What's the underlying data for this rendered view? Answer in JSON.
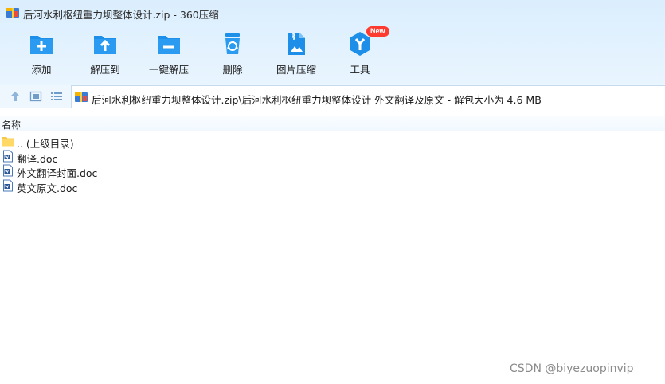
{
  "window": {
    "title": "后河水利枢纽重力坝整体设计.zip - 360压缩"
  },
  "toolbar": {
    "items": [
      {
        "label": "添加",
        "icon": "add-folder-icon"
      },
      {
        "label": "解压到",
        "icon": "extract-to-icon"
      },
      {
        "label": "一键解压",
        "icon": "one-click-extract-icon"
      },
      {
        "label": "删除",
        "icon": "trash-icon"
      },
      {
        "label": "图片压缩",
        "icon": "image-compress-icon"
      },
      {
        "label": "工具",
        "icon": "tools-icon",
        "badge": "New"
      }
    ]
  },
  "address_bar": {
    "path": "后河水利枢纽重力坝整体设计.zip\\后河水利枢纽重力坝整体设计 外文翻译及原文 - 解包大小为 4.6 MB"
  },
  "file_list": {
    "column_header": "名称",
    "rows": [
      {
        "name": ".. (上级目录)",
        "type": "parent-folder"
      },
      {
        "name": "翻译.doc",
        "type": "doc"
      },
      {
        "name": "外文翻译封面.doc",
        "type": "doc"
      },
      {
        "name": "英文原文.doc",
        "type": "doc"
      }
    ]
  },
  "watermark": "CSDN @biyezuopinvip",
  "colors": {
    "accent": "#1e8fe8",
    "toolbar_bg": "#e3f2fe",
    "badge": "#ff3b30"
  }
}
